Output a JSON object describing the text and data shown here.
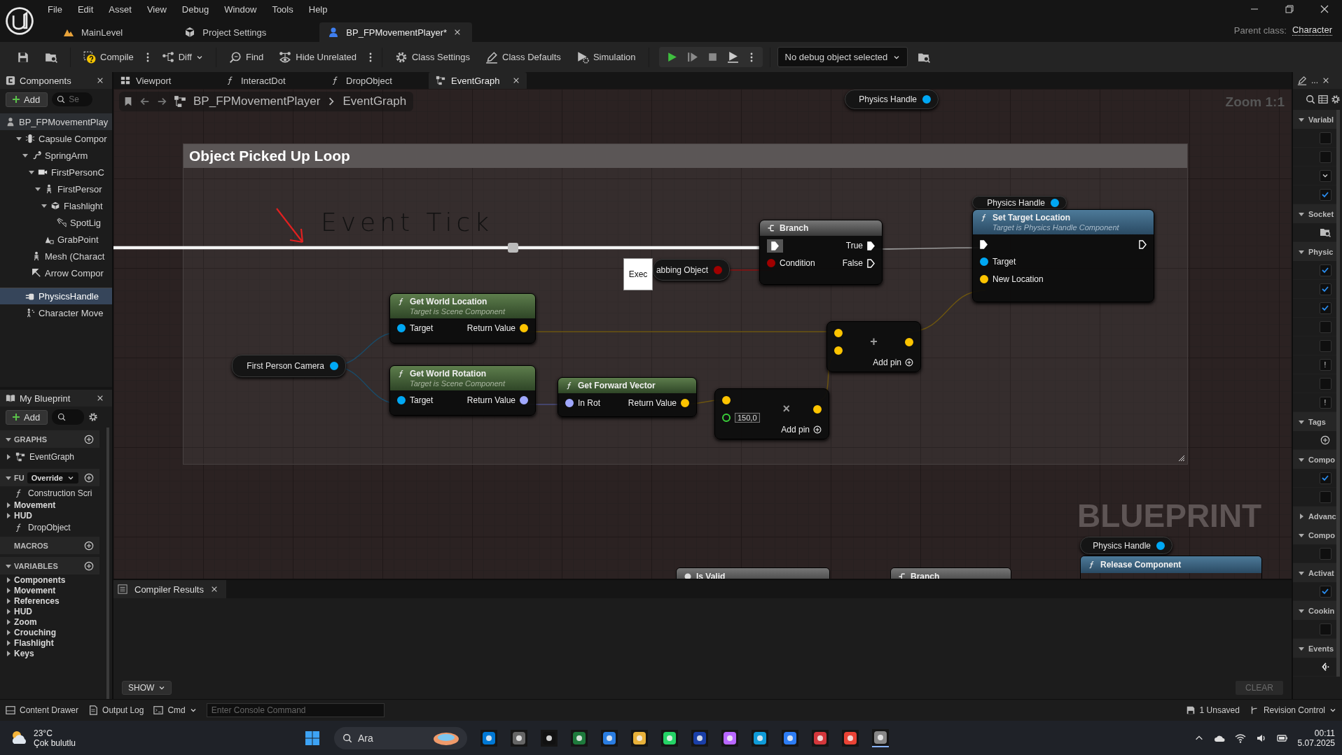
{
  "menu": [
    "File",
    "Edit",
    "Asset",
    "View",
    "Debug",
    "Window",
    "Tools",
    "Help"
  ],
  "document_tabs": [
    {
      "label": "MainLevel",
      "kind": "level",
      "selected": false
    },
    {
      "label": "Project Settings",
      "kind": "settings",
      "selected": false
    },
    {
      "label": "BP_FPMovementPlayer*",
      "kind": "blueprint",
      "selected": true
    }
  ],
  "parent_class": {
    "label": "Parent class:",
    "value": "Character"
  },
  "toolbar": [
    {
      "kind": "compile",
      "label": "Compile",
      "more": true
    },
    {
      "kind": "diff",
      "label": "Diff",
      "dropdown": true
    },
    {
      "kind": "find",
      "label": "Find"
    },
    {
      "kind": "hide",
      "label": "Hide Unrelated",
      "more": true
    },
    {
      "kind": "class_settings",
      "label": "Class Settings"
    },
    {
      "kind": "class_defaults",
      "label": "Class Defaults"
    },
    {
      "kind": "simulation",
      "label": "Simulation"
    }
  ],
  "debug_object": "No debug object selected",
  "components": {
    "title": "Components",
    "add": "Add",
    "search_placeholder": "Se",
    "tree": [
      {
        "label": "BP_FPMovementPlay",
        "kind": "actor",
        "selected": false,
        "children": [
          {
            "label": "Capsule Compor",
            "kind": "capsule",
            "expanded": true,
            "selected": false,
            "children": [
              {
                "label": "SpringArm",
                "kind": "spring",
                "expanded": true,
                "selected": false,
                "children": [
                  {
                    "label": "FirstPersonC",
                    "kind": "camera",
                    "expanded": true,
                    "selected": false,
                    "children": [
                      {
                        "label": "FirstPersor",
                        "kind": "skeleton",
                        "expanded": true,
                        "selected": false,
                        "children": [
                          {
                            "label": "Flashlight",
                            "kind": "box",
                            "expanded": true,
                            "selected": false,
                            "children": [
                              {
                                "label": "SpotLig",
                                "kind": "spotlight",
                                "selected": false
                              }
                            ]
                          }
                        ]
                      },
                      {
                        "label": "GrabPoint",
                        "kind": "scene",
                        "selected": false
                      }
                    ]
                  }
                ]
              },
              {
                "label": "Mesh (Charact",
                "kind": "skeleton",
                "selected": false
              },
              {
                "label": "Arrow Compor",
                "kind": "arrow",
                "selected": false
              }
            ]
          },
          {
            "label": "PhysicsHandle",
            "kind": "handle",
            "selected": true
          },
          {
            "label": "Character Move",
            "kind": "movement",
            "selected": false
          }
        ]
      }
    ]
  },
  "my_blueprint": {
    "title": "My Blueprint",
    "add": "Add",
    "sections": [
      {
        "title": "GRAPHS",
        "expanded": true,
        "items": [
          {
            "label": "EventGraph",
            "kind": "graph",
            "expanded": false
          }
        ]
      },
      {
        "title": "FU",
        "expanded": true,
        "filter": "Override",
        "items": [
          {
            "label": "Construction Scri",
            "kind": "function"
          },
          {
            "label": "Movement",
            "kind": "category",
            "expanded": false
          },
          {
            "label": "HUD",
            "kind": "category",
            "expanded": false
          },
          {
            "label": "DropObject",
            "kind": "function"
          }
        ]
      },
      {
        "title": "MACROS"
      },
      {
        "title": "VARIABLES",
        "expanded": true,
        "items": [
          {
            "label": "Components",
            "kind": "category",
            "expanded": false
          },
          {
            "label": "Movement",
            "kind": "category",
            "expanded": false
          },
          {
            "label": "References",
            "kind": "category",
            "expanded": false
          },
          {
            "label": "HUD",
            "kind": "category",
            "expanded": false
          },
          {
            "label": "Zoom",
            "kind": "category",
            "expanded": false
          },
          {
            "label": "Crouching",
            "kind": "category",
            "expanded": false
          },
          {
            "label": "Flashlight",
            "kind": "category",
            "expanded": false
          },
          {
            "label": "Keys",
            "kind": "category",
            "expanded": false
          }
        ]
      }
    ]
  },
  "editor_tabs": [
    {
      "label": "Viewport",
      "kind": "viewport",
      "selected": false
    },
    {
      "label": "InteractDot",
      "kind": "function",
      "selected": false
    },
    {
      "label": "DropObject",
      "kind": "function",
      "selected": false
    },
    {
      "label": "EventGraph",
      "kind": "graph",
      "selected": true
    }
  ],
  "graph": {
    "breadcrumb": [
      "BP_FPMovementPlayer",
      "EventGraph"
    ],
    "zoom": "Zoom 1:1",
    "comment": "Object Picked Up Loop",
    "annotation": "Event Tick",
    "watermark": "BLUEPRINT",
    "nodes": [
      {
        "kind": "getter",
        "label": "Physics Handle",
        "color": "#00a8f4"
      },
      {
        "kind": "getter",
        "label": "Physics Handle",
        "color": "#00a8f4"
      },
      {
        "kind": "branch",
        "title": "Branch",
        "inputs": [
          {
            "kind": "exec",
            "connected": true
          },
          {
            "label": "Condition",
            "kind": "data",
            "color": "#a00000",
            "connected": true
          }
        ],
        "outputs": [
          {
            "label": "True",
            "kind": "exec",
            "connected": true
          },
          {
            "label": "False",
            "kind": "exec",
            "connected": false
          }
        ]
      },
      {
        "kind": "function",
        "title": "Set Target Location",
        "subtitle": "Target is Physics Handle Component",
        "inputs": [
          {
            "kind": "exec",
            "connected": true
          },
          {
            "label": "Target",
            "kind": "data",
            "color": "#00a8f4",
            "connected": true
          },
          {
            "label": "New Location",
            "kind": "data",
            "color": "#fdc400",
            "connected": true
          }
        ],
        "outputs": [
          {
            "kind": "exec",
            "connected": false
          }
        ]
      },
      {
        "kind": "getter",
        "label": "abbing Object",
        "color": "#a00000",
        "tooltip": "Exec"
      },
      {
        "kind": "pure_function",
        "title": "Get World Location",
        "subtitle": "Target is Scene Component",
        "inputs": [
          {
            "label": "Target",
            "kind": "data",
            "color": "#00a8f4",
            "connected": true
          }
        ],
        "outputs": [
          {
            "label": "Return Value",
            "kind": "data",
            "color": "#fdc400",
            "connected": true
          }
        ]
      },
      {
        "kind": "getter",
        "label": "First Person Camera",
        "color": "#00a8f4"
      },
      {
        "kind": "pure_function",
        "title": "Get World Rotation",
        "subtitle": "Target is Scene Component",
        "inputs": [
          {
            "label": "Target",
            "kind": "data",
            "color": "#00a8f4",
            "connected": true
          }
        ],
        "outputs": [
          {
            "label": "Return Value",
            "kind": "data",
            "color": "#a0a8ff",
            "connected": true
          }
        ]
      },
      {
        "kind": "pure_function",
        "title": "Get Forward Vector",
        "inputs": [
          {
            "label": "In Rot",
            "kind": "data",
            "color": "#a0a8ff",
            "connected": true
          }
        ],
        "outputs": [
          {
            "label": "Return Value",
            "kind": "data",
            "color": "#fdc400",
            "connected": true
          }
        ]
      },
      {
        "kind": "math",
        "symbol": "+",
        "add_pin": "Add pin",
        "inputs": [
          {
            "kind": "data",
            "color": "#fdc400",
            "connected": true
          },
          {
            "kind": "data",
            "color": "#fdc400",
            "connected": true
          }
        ],
        "outputs": [
          {
            "kind": "data",
            "color": "#fdc400",
            "connected": true
          }
        ]
      },
      {
        "kind": "math",
        "symbol": "×",
        "add_pin": "Add pin",
        "inputs": [
          {
            "kind": "data",
            "color": "#fdc400",
            "connected": true
          },
          {
            "kind": "data",
            "color": "#3ad13a",
            "connected": false,
            "value": "150,0"
          }
        ],
        "outputs": [
          {
            "kind": "data",
            "color": "#fdc400",
            "connected": true
          }
        ]
      },
      {
        "kind": "getter",
        "label": "Physics Handle",
        "color": "#00a8f4"
      },
      {
        "kind": "call_stub",
        "title": "Release Component"
      },
      {
        "kind": "macro_stub",
        "title": "Is Valid"
      },
      {
        "kind": "branch_stub",
        "title": "Branch"
      }
    ]
  },
  "details": {
    "title": "...",
    "sections": [
      {
        "title": "Variabl",
        "expanded": true,
        "rows": [
          {
            "kind": "checkbox",
            "checked": false
          },
          {
            "kind": "checkbox",
            "checked": false
          },
          {
            "kind": "dropdown"
          },
          {
            "kind": "checkbox",
            "checked": true
          }
        ]
      },
      {
        "title": "Socket",
        "expanded": true,
        "rows": [
          {
            "kind": "browse"
          }
        ]
      },
      {
        "title": "Physic",
        "expanded": true,
        "rows": [
          {
            "kind": "checkbox",
            "checked": true
          },
          {
            "kind": "checkbox",
            "checked": true
          },
          {
            "kind": "checkbox",
            "checked": true
          },
          {
            "kind": "field"
          },
          {
            "kind": "field"
          },
          {
            "kind": "field",
            "value": "!"
          },
          {
            "kind": "field"
          },
          {
            "kind": "field",
            "value": "!"
          }
        ]
      },
      {
        "title": "Tags",
        "expanded": true,
        "rows": [
          {
            "kind": "add"
          }
        ]
      },
      {
        "title": "Compo",
        "expanded": true,
        "rows": [
          {
            "kind": "checkbox",
            "checked": true
          },
          {
            "kind": "field"
          }
        ]
      },
      {
        "title": "Advanc",
        "expanded": false
      },
      {
        "title": "Compo",
        "expanded": true,
        "rows": [
          {
            "kind": "checkbox",
            "checked": false
          }
        ]
      },
      {
        "title": "Activat",
        "expanded": true,
        "rows": [
          {
            "kind": "checkbox",
            "checked": true
          }
        ]
      },
      {
        "title": "Cookin",
        "expanded": true,
        "rows": [
          {
            "kind": "checkbox",
            "checked": false
          }
        ]
      },
      {
        "title": "Events",
        "expanded": true,
        "rows": [
          {
            "kind": "event"
          }
        ]
      }
    ]
  },
  "compiler": {
    "tab": "Compiler Results",
    "show": "SHOW",
    "clear": {
      "label": "CLEAR",
      "disabled": true
    }
  },
  "status_bar": {
    "content_drawer": "Content Drawer",
    "output_log": "Output Log",
    "cmd": "Cmd",
    "console_placeholder": "Enter Console Command",
    "unsaved": "1 Unsaved",
    "revision_control": "Revision Control"
  },
  "taskbar": {
    "temperature": "23°C",
    "weather": "Çok bulutlu",
    "search_placeholder": "Ara",
    "time": "00:11",
    "date": "5.07.2025"
  }
}
